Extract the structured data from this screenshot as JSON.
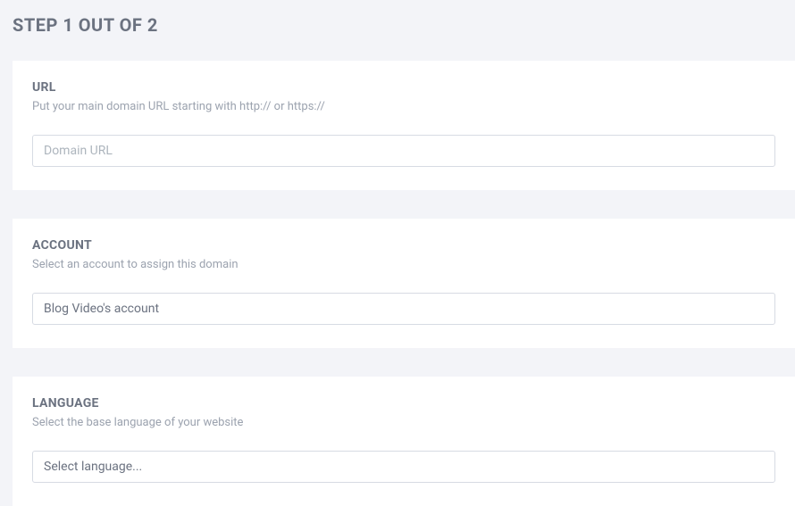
{
  "step_title": "STEP 1 OUT OF 2",
  "url_section": {
    "title": "URL",
    "description": "Put your main domain URL starting with http:// or https://",
    "placeholder": "Domain URL",
    "value": ""
  },
  "account_section": {
    "title": "ACCOUNT",
    "description": "Select an account to assign this domain",
    "selected": "Blog Video's account"
  },
  "language_section": {
    "title": "LANGUAGE",
    "description": "Select the base language of your website",
    "selected": "Select language..."
  }
}
